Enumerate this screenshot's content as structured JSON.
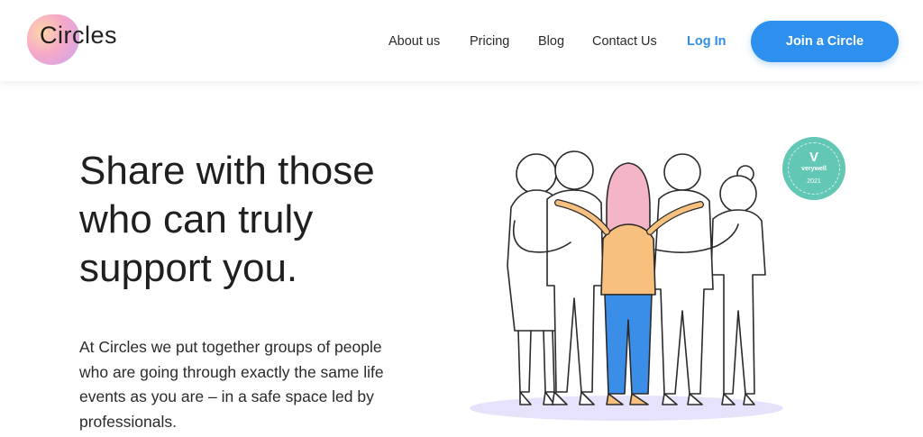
{
  "brand": {
    "name": "Circles"
  },
  "nav": {
    "items": [
      "About us",
      "Pricing",
      "Blog",
      "Contact Us"
    ],
    "login_label": "Log In",
    "cta_label": "Join a Circle"
  },
  "hero": {
    "headline_lines": [
      "Share with those",
      "who can truly",
      "support you."
    ],
    "body_lines": [
      "At Circles we put together groups of people",
      "who are going through exactly the same life",
      "events as you are – in a safe space led by",
      "professionals."
    ]
  },
  "badge": {
    "brand": "verywell",
    "year": "2021",
    "mark": "V"
  },
  "colors": {
    "accent": "#2e90ee",
    "login": "#2f8fe6",
    "badge": "#63c7b6",
    "figure_top": "#f8c07f",
    "figure_pants": "#3b8ee8",
    "figure_hair": "#f4b6c6",
    "shadow": "#e6e2fb"
  }
}
